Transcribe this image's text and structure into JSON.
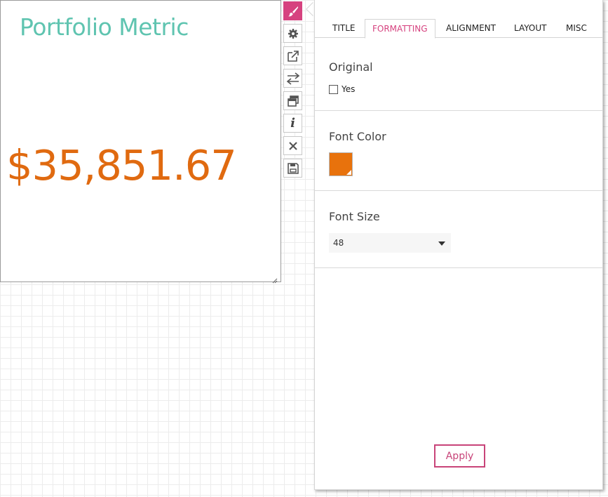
{
  "widget": {
    "title": "Portfolio Metric",
    "value": "$35,851.67"
  },
  "toolbar": {
    "buttons": [
      {
        "icon": "paintbrush-icon",
        "active": true
      },
      {
        "icon": "gear-icon",
        "active": false
      },
      {
        "icon": "external-link-icon",
        "active": false
      },
      {
        "icon": "swap-arrows-icon",
        "active": false
      },
      {
        "icon": "copy-windows-icon",
        "active": false
      },
      {
        "icon": "info-icon",
        "active": false
      },
      {
        "icon": "close-icon",
        "active": false
      },
      {
        "icon": "save-icon",
        "active": false
      }
    ]
  },
  "panel": {
    "tabs": [
      {
        "label": "TITLE",
        "active": false
      },
      {
        "label": "FORMATTING",
        "active": true
      },
      {
        "label": "ALIGNMENT",
        "active": false
      },
      {
        "label": "LAYOUT",
        "active": false
      },
      {
        "label": "MISC",
        "active": false
      }
    ],
    "original": {
      "label": "Original",
      "checkbox_label": "Yes",
      "checked": false
    },
    "font_color": {
      "label": "Font Color",
      "value": "#e8720c"
    },
    "font_size": {
      "label": "Font Size",
      "value": "48"
    },
    "apply_label": "Apply"
  },
  "colors": {
    "accent": "#d6427f",
    "title_color": "#5fc4b0",
    "value_color": "#e06a10"
  }
}
